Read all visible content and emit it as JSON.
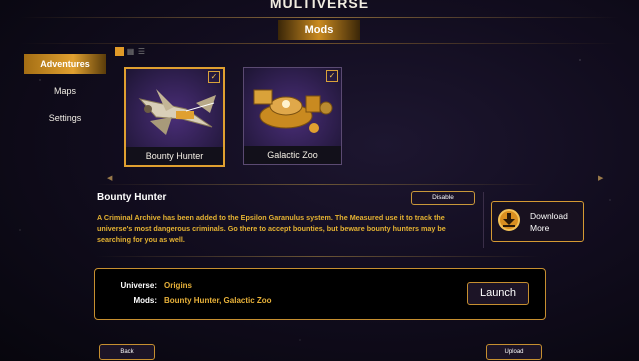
{
  "title": "MULTIVERSE",
  "banner": {
    "label": "Mods"
  },
  "sidebar": {
    "items": [
      {
        "label": "Adventures",
        "active": true
      },
      {
        "label": "Maps",
        "active": false
      },
      {
        "label": "Settings",
        "active": false
      }
    ]
  },
  "view_toggle": {
    "selected": "large-grid"
  },
  "mods": [
    {
      "name": "Bounty Hunter",
      "enabled": true,
      "check": "✓"
    },
    {
      "name": "Galactic Zoo",
      "enabled": true,
      "check": "✓"
    }
  ],
  "carousel": {
    "prev": "◀",
    "next": "▶"
  },
  "detail": {
    "title": "Bounty Hunter",
    "disable_label": "Disable",
    "description": "A Criminal Archive has been added to the Epsilon Garanulus system. The Measured use it to track the universe's most dangerous criminals. Go there to accept bounties, but beware bounty hunters may be searching for you as well."
  },
  "download": {
    "label_line1": "Download",
    "label_line2": "More"
  },
  "summary": {
    "universe_label": "Universe:",
    "universe_value": "Origins",
    "mods_label": "Mods:",
    "mods_value": "Bounty Hunter, Galactic Zoo",
    "launch_label": "Launch"
  },
  "footer": {
    "back_label": "Back",
    "upload_label": "Upload"
  },
  "colors": {
    "accent": "#e0a030",
    "text_gold": "#e4b232"
  }
}
